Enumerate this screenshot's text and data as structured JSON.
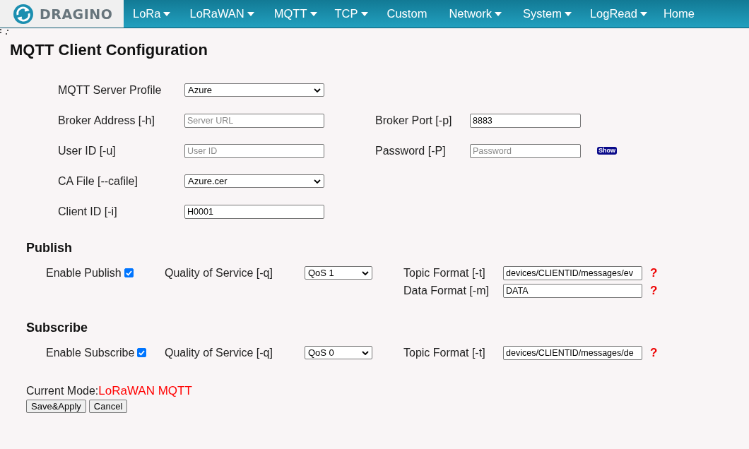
{
  "nav": {
    "logo": "DRAGINO",
    "items": [
      {
        "label": "LoRa",
        "dropdown": true
      },
      {
        "label": "LoRaWAN",
        "dropdown": true
      },
      {
        "label": "MQTT",
        "dropdown": true
      },
      {
        "label": "TCP",
        "dropdown": true
      },
      {
        "label": "Custom",
        "dropdown": false
      },
      {
        "label": "Network",
        "dropdown": true
      },
      {
        "label": "System",
        "dropdown": true
      },
      {
        "label": "LogRead",
        "dropdown": true
      },
      {
        "label": "Home",
        "dropdown": false
      }
    ]
  },
  "title": "MQTT Client Configuration",
  "server_rows": [
    {
      "fields": [
        {
          "label": "MQTT Server Profile",
          "kind": "select",
          "value": "Azure"
        }
      ]
    },
    {
      "fields": [
        {
          "label": "Broker Address [-h]",
          "kind": "text",
          "placeholder": "Server URL"
        },
        {
          "label": "Broker Port [-p]",
          "kind": "text",
          "value": "8883"
        }
      ]
    },
    {
      "fields": [
        {
          "label": "User ID [-u]",
          "kind": "text",
          "placeholder": "User ID"
        },
        {
          "label": "Password [-P]",
          "kind": "password",
          "placeholder": "Password",
          "show_button": "Show"
        }
      ]
    },
    {
      "fields": [
        {
          "label": "CA File [--cafile]",
          "kind": "select",
          "value": "Azure.cer"
        }
      ]
    },
    {
      "fields": [
        {
          "label": "Client ID [-i]",
          "kind": "text",
          "value": "H0001"
        }
      ]
    }
  ],
  "sections": [
    {
      "heading": "Publish",
      "enable_label": "Enable Publish",
      "enabled": true,
      "qos_label": "Quality of Service [-q]",
      "qos": "QoS 1",
      "formats": [
        {
          "label": "Topic Format [-t]",
          "value": "devices/CLIENTID/messages/ev",
          "help": "?"
        },
        {
          "label": "Data Format [-m]",
          "value": "DATA",
          "help": "?"
        }
      ]
    },
    {
      "heading": "Subscribe",
      "enable_label": "Enable Subscribe",
      "enabled": true,
      "qos_label": "Quality of Service [-q]",
      "qos": "QoS 0",
      "formats": [
        {
          "label": "Topic Format [-t]",
          "value": "devices/CLIENTID/messages/de",
          "help": "?"
        }
      ]
    }
  ],
  "current_mode": {
    "label": "Current Mode:",
    "value": "LoRaWAN MQTT"
  },
  "buttons": [
    "Save&Apply",
    "Cancel"
  ]
}
